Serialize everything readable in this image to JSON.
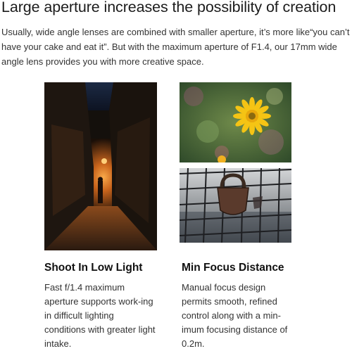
{
  "headline": "Large aperture increases the possibility of creation",
  "intro": "Usually, wide angle lenses are combined with smaller aperture, it’s more like“you can’t have your cake and eat it”. But with the maximum aperture of F1.4, our 17mm wide angle lens provides you with more creative space.",
  "features": [
    {
      "title": "Shoot In Low Light",
      "description": "Fast f/1.4 maximum aperture supports work-ing in difficult lighting conditions with greater light intake."
    },
    {
      "title": "Min Focus Distance",
      "description": "Manual focus design permits smooth, refined control along with a min-imum focusing distance of 0.2m."
    }
  ],
  "colors": {
    "text": "#1c1c1c",
    "flower_petal": "#f5c414",
    "alley_glow": "#e07a1e"
  }
}
